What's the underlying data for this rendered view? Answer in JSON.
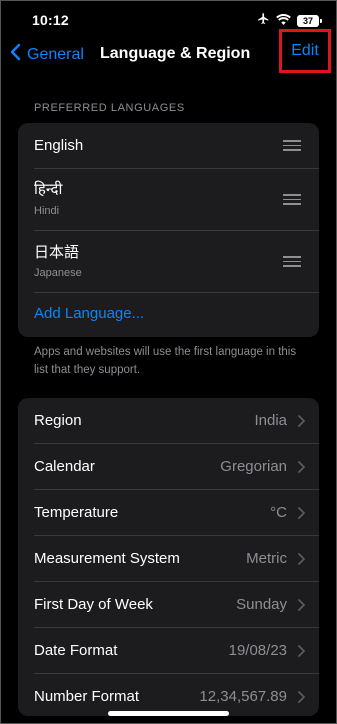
{
  "status": {
    "time": "10:12",
    "battery": "37"
  },
  "nav": {
    "back_label": "General",
    "title": "Language & Region",
    "edit_label": "Edit"
  },
  "preferred_languages": {
    "header": "PREFERRED LANGUAGES",
    "items": [
      {
        "name": "English",
        "subtitle": ""
      },
      {
        "name": "हिन्दी",
        "subtitle": "Hindi"
      },
      {
        "name": "日本語",
        "subtitle": "Japanese"
      }
    ],
    "add_label": "Add Language...",
    "footnote": "Apps and websites will use the first language in this list that they support."
  },
  "settings": [
    {
      "label": "Region",
      "value": "India"
    },
    {
      "label": "Calendar",
      "value": "Gregorian"
    },
    {
      "label": "Temperature",
      "value": "°C"
    },
    {
      "label": "Measurement System",
      "value": "Metric"
    },
    {
      "label": "First Day of Week",
      "value": "Sunday"
    },
    {
      "label": "Date Format",
      "value": "19/08/23"
    },
    {
      "label": "Number Format",
      "value": "12,34,567.89"
    }
  ],
  "colors": {
    "accent": "#0a84ff",
    "highlight": "#e0141c",
    "cell": "#1c1c1e"
  }
}
